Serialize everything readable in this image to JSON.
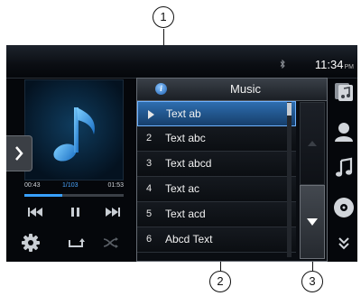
{
  "status": {
    "time": "11:34",
    "ampm": "PM"
  },
  "player": {
    "elapsed": "00:43",
    "track_position": "1/103",
    "total": "01:53",
    "progress": 0.38
  },
  "list": {
    "title": "Music",
    "items": [
      {
        "index": "",
        "label": "Text ab",
        "selected": true
      },
      {
        "index": "2",
        "label": "Text abc"
      },
      {
        "index": "3",
        "label": "Text abcd"
      },
      {
        "index": "4",
        "label": "Text ac"
      },
      {
        "index": "5",
        "label": "Text acd"
      },
      {
        "index": "6",
        "label": "Abcd Text"
      }
    ]
  },
  "callouts": [
    "1",
    "2",
    "3"
  ],
  "icons": {
    "album_art": "music-note-icon",
    "expand": "chevron-right-icon",
    "prev": "skip-previous-icon",
    "pause": "pause-icon",
    "next": "skip-next-icon",
    "settings": "gear-icon",
    "repeat": "repeat-icon",
    "shuffle": "shuffle-icon",
    "info": "info-icon",
    "side": [
      "music-folder-icon",
      "artist-icon",
      "music-note-icon",
      "disc-icon",
      "double-chevron-down-icon"
    ]
  },
  "colors": {
    "accent": "#38a0ff",
    "selected_row": "#2e6eb0",
    "screen_bg": "#05070b"
  }
}
